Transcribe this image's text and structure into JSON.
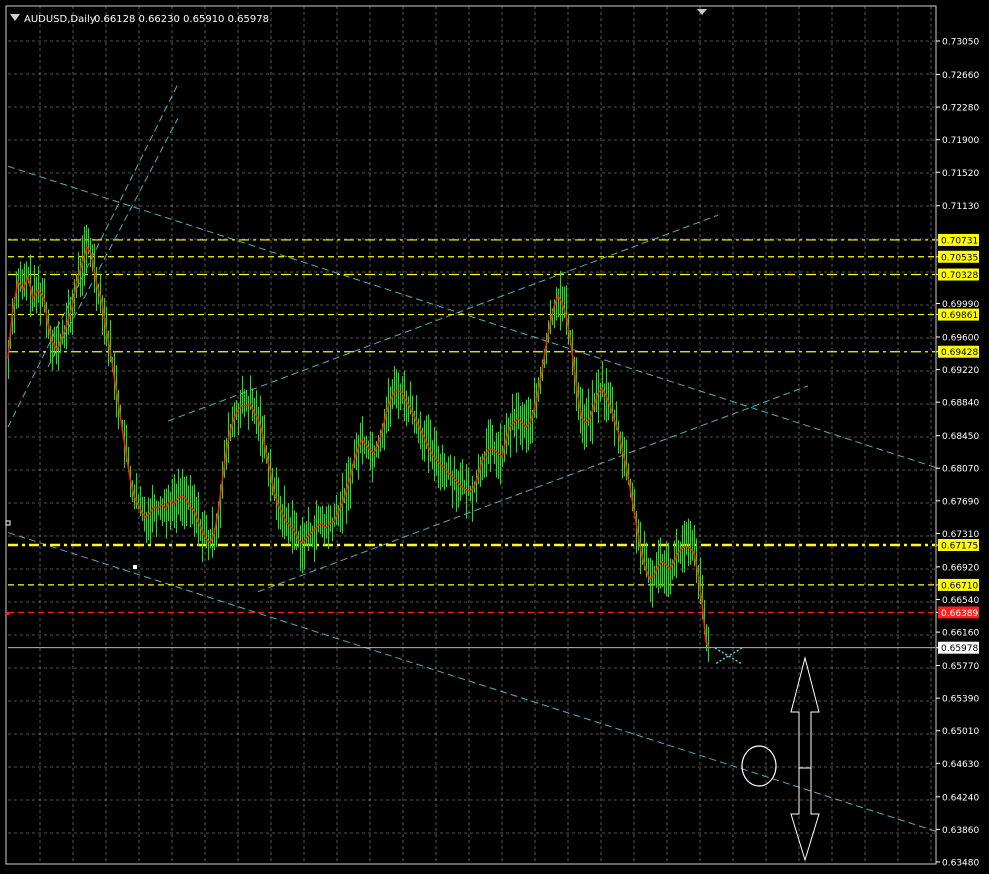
{
  "header": {
    "symbol": "AUDUSD,Daily",
    "ohlc": "0.66128 0.66230 0.65910 0.65978"
  },
  "colors": {
    "background": "#000000",
    "grid": "#c8c8c8",
    "axis": "#ffffff",
    "candle": "#22dd22",
    "ma": "#ff2200",
    "level": "#ffff00",
    "support": "#ff2020",
    "trendline": "#5ad1d6",
    "current": "#d0d0d0"
  },
  "price_axis": {
    "labels": [
      "0.73050",
      "0.72660",
      "0.72280",
      "0.71900",
      "0.71520",
      "0.71130",
      "0.70731",
      "0.70535",
      "0.70328",
      "0.69990",
      "0.69861",
      "0.69600",
      "0.69428",
      "0.69220",
      "0.68840",
      "0.68450",
      "0.68070",
      "0.67690",
      "0.67310",
      "0.67175",
      "0.66920",
      "0.66710",
      "0.66540",
      "0.66389",
      "0.66160",
      "0.65978",
      "0.65770",
      "0.65390",
      "0.65010",
      "0.64630",
      "0.64240",
      "0.63860",
      "0.63480"
    ]
  },
  "chart_data": {
    "type": "candlestick",
    "title": "AUDUSD,Daily",
    "ylim": [
      0.6348,
      0.7345
    ],
    "last_price": 0.65978,
    "horizontal_levels": [
      {
        "price": 0.70731,
        "color": "#ffff00",
        "style": "dash-dot",
        "label": "0.70731"
      },
      {
        "price": 0.70535,
        "color": "#ffff00",
        "style": "dashed",
        "label": "0.70535"
      },
      {
        "price": 0.70328,
        "color": "#ffff00",
        "style": "dash-dot",
        "label": "0.70328"
      },
      {
        "price": 0.69861,
        "color": "#ffff00",
        "style": "dashed",
        "label": "0.69861"
      },
      {
        "price": 0.69428,
        "color": "#ffff00",
        "style": "dash-dot",
        "label": "0.69428"
      },
      {
        "price": 0.67175,
        "color": "#ffff00",
        "style": "thick-dash-dot",
        "label": "0.67175"
      },
      {
        "price": 0.6671,
        "color": "#ffff00",
        "style": "dashed",
        "label": "0.66710"
      },
      {
        "price": 0.66389,
        "color": "#ff2020",
        "style": "dashed",
        "label": "0.66389"
      }
    ],
    "close_path": [
      [
        0,
        0.6935
      ],
      [
        4,
        0.6985
      ],
      [
        10,
        0.7025
      ],
      [
        15,
        0.7015
      ],
      [
        20,
        0.703
      ],
      [
        25,
        0.7005
      ],
      [
        30,
        0.7015
      ],
      [
        36,
        0.7005
      ],
      [
        40,
        0.6975
      ],
      [
        44,
        0.6955
      ],
      [
        49,
        0.6945
      ],
      [
        54,
        0.696
      ],
      [
        59,
        0.6975
      ],
      [
        64,
        0.6995
      ],
      [
        69,
        0.7025
      ],
      [
        74,
        0.7045
      ],
      [
        79,
        0.7065
      ],
      [
        84,
        0.7055
      ],
      [
        89,
        0.702
      ],
      [
        94,
        0.7
      ],
      [
        98,
        0.697
      ],
      [
        102,
        0.6945
      ],
      [
        106,
        0.6915
      ],
      [
        110,
        0.6885
      ],
      [
        114,
        0.6855
      ],
      [
        118,
        0.6825
      ],
      [
        122,
        0.6795
      ],
      [
        126,
        0.6775
      ],
      [
        130,
        0.6765
      ],
      [
        134,
        0.6755
      ],
      [
        138,
        0.675
      ],
      [
        142,
        0.6755
      ],
      [
        146,
        0.6762
      ],
      [
        150,
        0.676
      ],
      [
        154,
        0.6765
      ],
      [
        158,
        0.676
      ],
      [
        162,
        0.677
      ],
      [
        166,
        0.6765
      ],
      [
        170,
        0.6772
      ],
      [
        174,
        0.6775
      ],
      [
        178,
        0.6772
      ],
      [
        182,
        0.6762
      ],
      [
        186,
        0.6758
      ],
      [
        190,
        0.6745
      ],
      [
        194,
        0.6735
      ],
      [
        198,
        0.6725
      ],
      [
        202,
        0.672
      ],
      [
        206,
        0.673
      ],
      [
        210,
        0.6755
      ],
      [
        214,
        0.679
      ],
      [
        218,
        0.6825
      ],
      [
        222,
        0.685
      ],
      [
        226,
        0.6865
      ],
      [
        230,
        0.6875
      ],
      [
        234,
        0.688
      ],
      [
        238,
        0.688
      ],
      [
        242,
        0.6882
      ],
      [
        246,
        0.6872
      ],
      [
        250,
        0.6865
      ],
      [
        254,
        0.685
      ],
      [
        258,
        0.6825
      ],
      [
        262,
        0.6805
      ],
      [
        266,
        0.678
      ],
      [
        270,
        0.6765
      ],
      [
        274,
        0.6755
      ],
      [
        278,
        0.6745
      ],
      [
        282,
        0.674
      ],
      [
        286,
        0.6735
      ],
      [
        290,
        0.6725
      ],
      [
        294,
        0.672
      ],
      [
        298,
        0.6725
      ],
      [
        302,
        0.673
      ],
      [
        306,
        0.6735
      ],
      [
        310,
        0.674
      ],
      [
        314,
        0.6742
      ],
      [
        318,
        0.6738
      ],
      [
        322,
        0.6742
      ],
      [
        326,
        0.6745
      ],
      [
        330,
        0.6755
      ],
      [
        334,
        0.6765
      ],
      [
        338,
        0.678
      ],
      [
        342,
        0.6795
      ],
      [
        346,
        0.6815
      ],
      [
        350,
        0.683
      ],
      [
        354,
        0.684
      ],
      [
        358,
        0.6835
      ],
      [
        362,
        0.6828
      ],
      [
        366,
        0.6825
      ],
      [
        370,
        0.6835
      ],
      [
        374,
        0.685
      ],
      [
        378,
        0.687
      ],
      [
        382,
        0.6885
      ],
      [
        386,
        0.6895
      ],
      [
        390,
        0.6898
      ],
      [
        394,
        0.6895
      ],
      [
        398,
        0.6885
      ],
      [
        402,
        0.6878
      ],
      [
        406,
        0.6868
      ],
      [
        410,
        0.6858
      ],
      [
        414,
        0.6848
      ],
      [
        418,
        0.6838
      ],
      [
        422,
        0.6828
      ],
      [
        426,
        0.682
      ],
      [
        430,
        0.6815
      ],
      [
        434,
        0.681
      ],
      [
        438,
        0.6805
      ],
      [
        442,
        0.68
      ],
      [
        446,
        0.6795
      ],
      [
        450,
        0.679
      ],
      [
        454,
        0.6785
      ],
      [
        458,
        0.6782
      ],
      [
        462,
        0.678
      ],
      [
        466,
        0.6785
      ],
      [
        470,
        0.6798
      ],
      [
        474,
        0.6815
      ],
      [
        478,
        0.6825
      ],
      [
        482,
        0.683
      ],
      [
        486,
        0.6828
      ],
      [
        490,
        0.6825
      ],
      [
        494,
        0.682
      ],
      [
        498,
        0.684
      ],
      [
        502,
        0.6855
      ],
      [
        506,
        0.686
      ],
      [
        510,
        0.6865
      ],
      [
        514,
        0.686
      ],
      [
        518,
        0.6855
      ],
      [
        522,
        0.686
      ],
      [
        526,
        0.6875
      ],
      [
        530,
        0.6895
      ],
      [
        534,
        0.692
      ],
      [
        538,
        0.695
      ],
      [
        542,
        0.6975
      ],
      [
        546,
        0.6995
      ],
      [
        550,
        0.7008
      ],
      [
        554,
        0.7
      ],
      [
        558,
        0.6985
      ],
      [
        562,
        0.696
      ],
      [
        566,
        0.6925
      ],
      [
        570,
        0.689
      ],
      [
        574,
        0.6865
      ],
      [
        578,
        0.686
      ],
      [
        582,
        0.6865
      ],
      [
        586,
        0.688
      ],
      [
        590,
        0.6895
      ],
      [
        594,
        0.69
      ],
      [
        598,
        0.6892
      ],
      [
        602,
        0.688
      ],
      [
        606,
        0.6865
      ],
      [
        610,
        0.685
      ],
      [
        614,
        0.683
      ],
      [
        618,
        0.681
      ],
      [
        622,
        0.6785
      ],
      [
        626,
        0.6758
      ],
      [
        630,
        0.673
      ],
      [
        634,
        0.6705
      ],
      [
        638,
        0.6688
      ],
      [
        642,
        0.6678
      ],
      [
        646,
        0.6682
      ],
      [
        650,
        0.6692
      ],
      [
        654,
        0.6698
      ],
      [
        658,
        0.6695
      ],
      [
        662,
        0.669
      ],
      [
        666,
        0.6698
      ],
      [
        670,
        0.6708
      ],
      [
        674,
        0.6714
      ],
      [
        678,
        0.6716
      ],
      [
        682,
        0.6714
      ],
      [
        686,
        0.6708
      ],
      [
        690,
        0.6685
      ],
      [
        694,
        0.665
      ],
      [
        698,
        0.6605
      ],
      [
        701,
        0.6598
      ]
    ],
    "trendlines": [
      {
        "from": [
          0,
          0.7159
        ],
        "to": [
          930,
          0.6807
        ],
        "style": "dashed"
      },
      {
        "from": [
          0,
          0.6732
        ],
        "to": [
          930,
          0.6383
        ],
        "style": "dashed"
      },
      {
        "from": [
          250,
          0.6663
        ],
        "to": [
          800,
          0.6903
        ],
        "style": "dashed"
      },
      {
        "from": [
          160,
          0.6862
        ],
        "to": [
          710,
          0.7102
        ],
        "style": "dashed"
      },
      {
        "from": [
          0,
          0.6855
        ],
        "to": [
          170,
          0.7255
        ],
        "style": "dashed"
      },
      {
        "from": [
          40,
          0.6925
        ],
        "to": [
          170,
          0.7215
        ],
        "style": "dashed"
      }
    ]
  }
}
